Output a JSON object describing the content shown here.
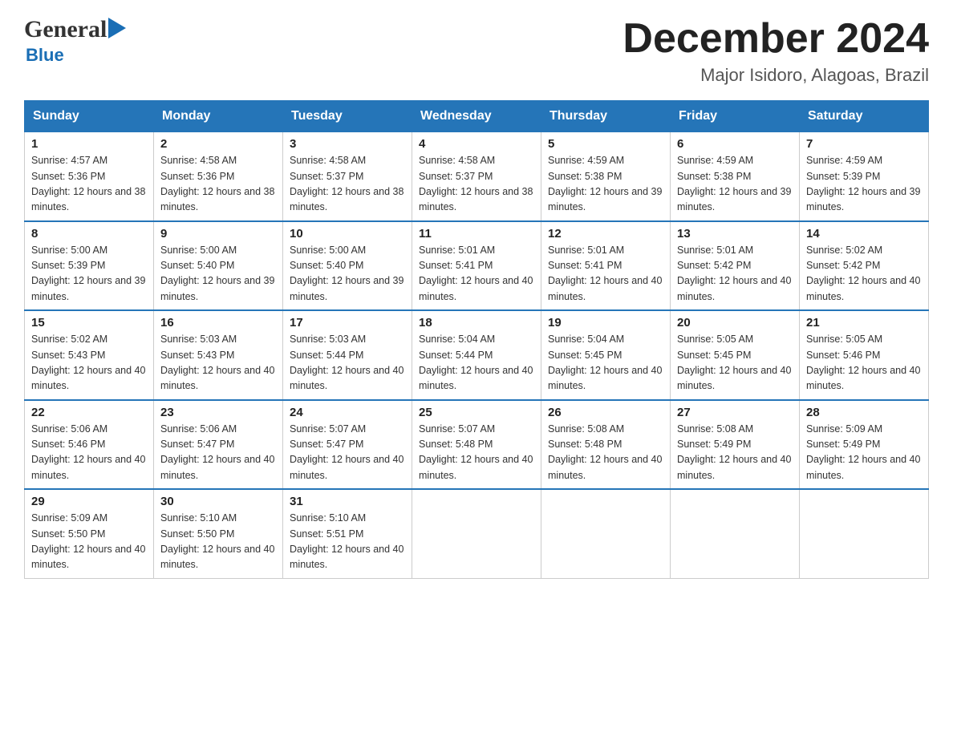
{
  "logo": {
    "general": "General",
    "blue": "Blue"
  },
  "title": "December 2024",
  "subtitle": "Major Isidoro, Alagoas, Brazil",
  "days_of_week": [
    "Sunday",
    "Monday",
    "Tuesday",
    "Wednesday",
    "Thursday",
    "Friday",
    "Saturday"
  ],
  "weeks": [
    [
      {
        "num": "1",
        "sunrise": "Sunrise: 4:57 AM",
        "sunset": "Sunset: 5:36 PM",
        "daylight": "Daylight: 12 hours and 38 minutes."
      },
      {
        "num": "2",
        "sunrise": "Sunrise: 4:58 AM",
        "sunset": "Sunset: 5:36 PM",
        "daylight": "Daylight: 12 hours and 38 minutes."
      },
      {
        "num": "3",
        "sunrise": "Sunrise: 4:58 AM",
        "sunset": "Sunset: 5:37 PM",
        "daylight": "Daylight: 12 hours and 38 minutes."
      },
      {
        "num": "4",
        "sunrise": "Sunrise: 4:58 AM",
        "sunset": "Sunset: 5:37 PM",
        "daylight": "Daylight: 12 hours and 38 minutes."
      },
      {
        "num": "5",
        "sunrise": "Sunrise: 4:59 AM",
        "sunset": "Sunset: 5:38 PM",
        "daylight": "Daylight: 12 hours and 39 minutes."
      },
      {
        "num": "6",
        "sunrise": "Sunrise: 4:59 AM",
        "sunset": "Sunset: 5:38 PM",
        "daylight": "Daylight: 12 hours and 39 minutes."
      },
      {
        "num": "7",
        "sunrise": "Sunrise: 4:59 AM",
        "sunset": "Sunset: 5:39 PM",
        "daylight": "Daylight: 12 hours and 39 minutes."
      }
    ],
    [
      {
        "num": "8",
        "sunrise": "Sunrise: 5:00 AM",
        "sunset": "Sunset: 5:39 PM",
        "daylight": "Daylight: 12 hours and 39 minutes."
      },
      {
        "num": "9",
        "sunrise": "Sunrise: 5:00 AM",
        "sunset": "Sunset: 5:40 PM",
        "daylight": "Daylight: 12 hours and 39 minutes."
      },
      {
        "num": "10",
        "sunrise": "Sunrise: 5:00 AM",
        "sunset": "Sunset: 5:40 PM",
        "daylight": "Daylight: 12 hours and 39 minutes."
      },
      {
        "num": "11",
        "sunrise": "Sunrise: 5:01 AM",
        "sunset": "Sunset: 5:41 PM",
        "daylight": "Daylight: 12 hours and 40 minutes."
      },
      {
        "num": "12",
        "sunrise": "Sunrise: 5:01 AM",
        "sunset": "Sunset: 5:41 PM",
        "daylight": "Daylight: 12 hours and 40 minutes."
      },
      {
        "num": "13",
        "sunrise": "Sunrise: 5:01 AM",
        "sunset": "Sunset: 5:42 PM",
        "daylight": "Daylight: 12 hours and 40 minutes."
      },
      {
        "num": "14",
        "sunrise": "Sunrise: 5:02 AM",
        "sunset": "Sunset: 5:42 PM",
        "daylight": "Daylight: 12 hours and 40 minutes."
      }
    ],
    [
      {
        "num": "15",
        "sunrise": "Sunrise: 5:02 AM",
        "sunset": "Sunset: 5:43 PM",
        "daylight": "Daylight: 12 hours and 40 minutes."
      },
      {
        "num": "16",
        "sunrise": "Sunrise: 5:03 AM",
        "sunset": "Sunset: 5:43 PM",
        "daylight": "Daylight: 12 hours and 40 minutes."
      },
      {
        "num": "17",
        "sunrise": "Sunrise: 5:03 AM",
        "sunset": "Sunset: 5:44 PM",
        "daylight": "Daylight: 12 hours and 40 minutes."
      },
      {
        "num": "18",
        "sunrise": "Sunrise: 5:04 AM",
        "sunset": "Sunset: 5:44 PM",
        "daylight": "Daylight: 12 hours and 40 minutes."
      },
      {
        "num": "19",
        "sunrise": "Sunrise: 5:04 AM",
        "sunset": "Sunset: 5:45 PM",
        "daylight": "Daylight: 12 hours and 40 minutes."
      },
      {
        "num": "20",
        "sunrise": "Sunrise: 5:05 AM",
        "sunset": "Sunset: 5:45 PM",
        "daylight": "Daylight: 12 hours and 40 minutes."
      },
      {
        "num": "21",
        "sunrise": "Sunrise: 5:05 AM",
        "sunset": "Sunset: 5:46 PM",
        "daylight": "Daylight: 12 hours and 40 minutes."
      }
    ],
    [
      {
        "num": "22",
        "sunrise": "Sunrise: 5:06 AM",
        "sunset": "Sunset: 5:46 PM",
        "daylight": "Daylight: 12 hours and 40 minutes."
      },
      {
        "num": "23",
        "sunrise": "Sunrise: 5:06 AM",
        "sunset": "Sunset: 5:47 PM",
        "daylight": "Daylight: 12 hours and 40 minutes."
      },
      {
        "num": "24",
        "sunrise": "Sunrise: 5:07 AM",
        "sunset": "Sunset: 5:47 PM",
        "daylight": "Daylight: 12 hours and 40 minutes."
      },
      {
        "num": "25",
        "sunrise": "Sunrise: 5:07 AM",
        "sunset": "Sunset: 5:48 PM",
        "daylight": "Daylight: 12 hours and 40 minutes."
      },
      {
        "num": "26",
        "sunrise": "Sunrise: 5:08 AM",
        "sunset": "Sunset: 5:48 PM",
        "daylight": "Daylight: 12 hours and 40 minutes."
      },
      {
        "num": "27",
        "sunrise": "Sunrise: 5:08 AM",
        "sunset": "Sunset: 5:49 PM",
        "daylight": "Daylight: 12 hours and 40 minutes."
      },
      {
        "num": "28",
        "sunrise": "Sunrise: 5:09 AM",
        "sunset": "Sunset: 5:49 PM",
        "daylight": "Daylight: 12 hours and 40 minutes."
      }
    ],
    [
      {
        "num": "29",
        "sunrise": "Sunrise: 5:09 AM",
        "sunset": "Sunset: 5:50 PM",
        "daylight": "Daylight: 12 hours and 40 minutes."
      },
      {
        "num": "30",
        "sunrise": "Sunrise: 5:10 AM",
        "sunset": "Sunset: 5:50 PM",
        "daylight": "Daylight: 12 hours and 40 minutes."
      },
      {
        "num": "31",
        "sunrise": "Sunrise: 5:10 AM",
        "sunset": "Sunset: 5:51 PM",
        "daylight": "Daylight: 12 hours and 40 minutes."
      },
      null,
      null,
      null,
      null
    ]
  ]
}
